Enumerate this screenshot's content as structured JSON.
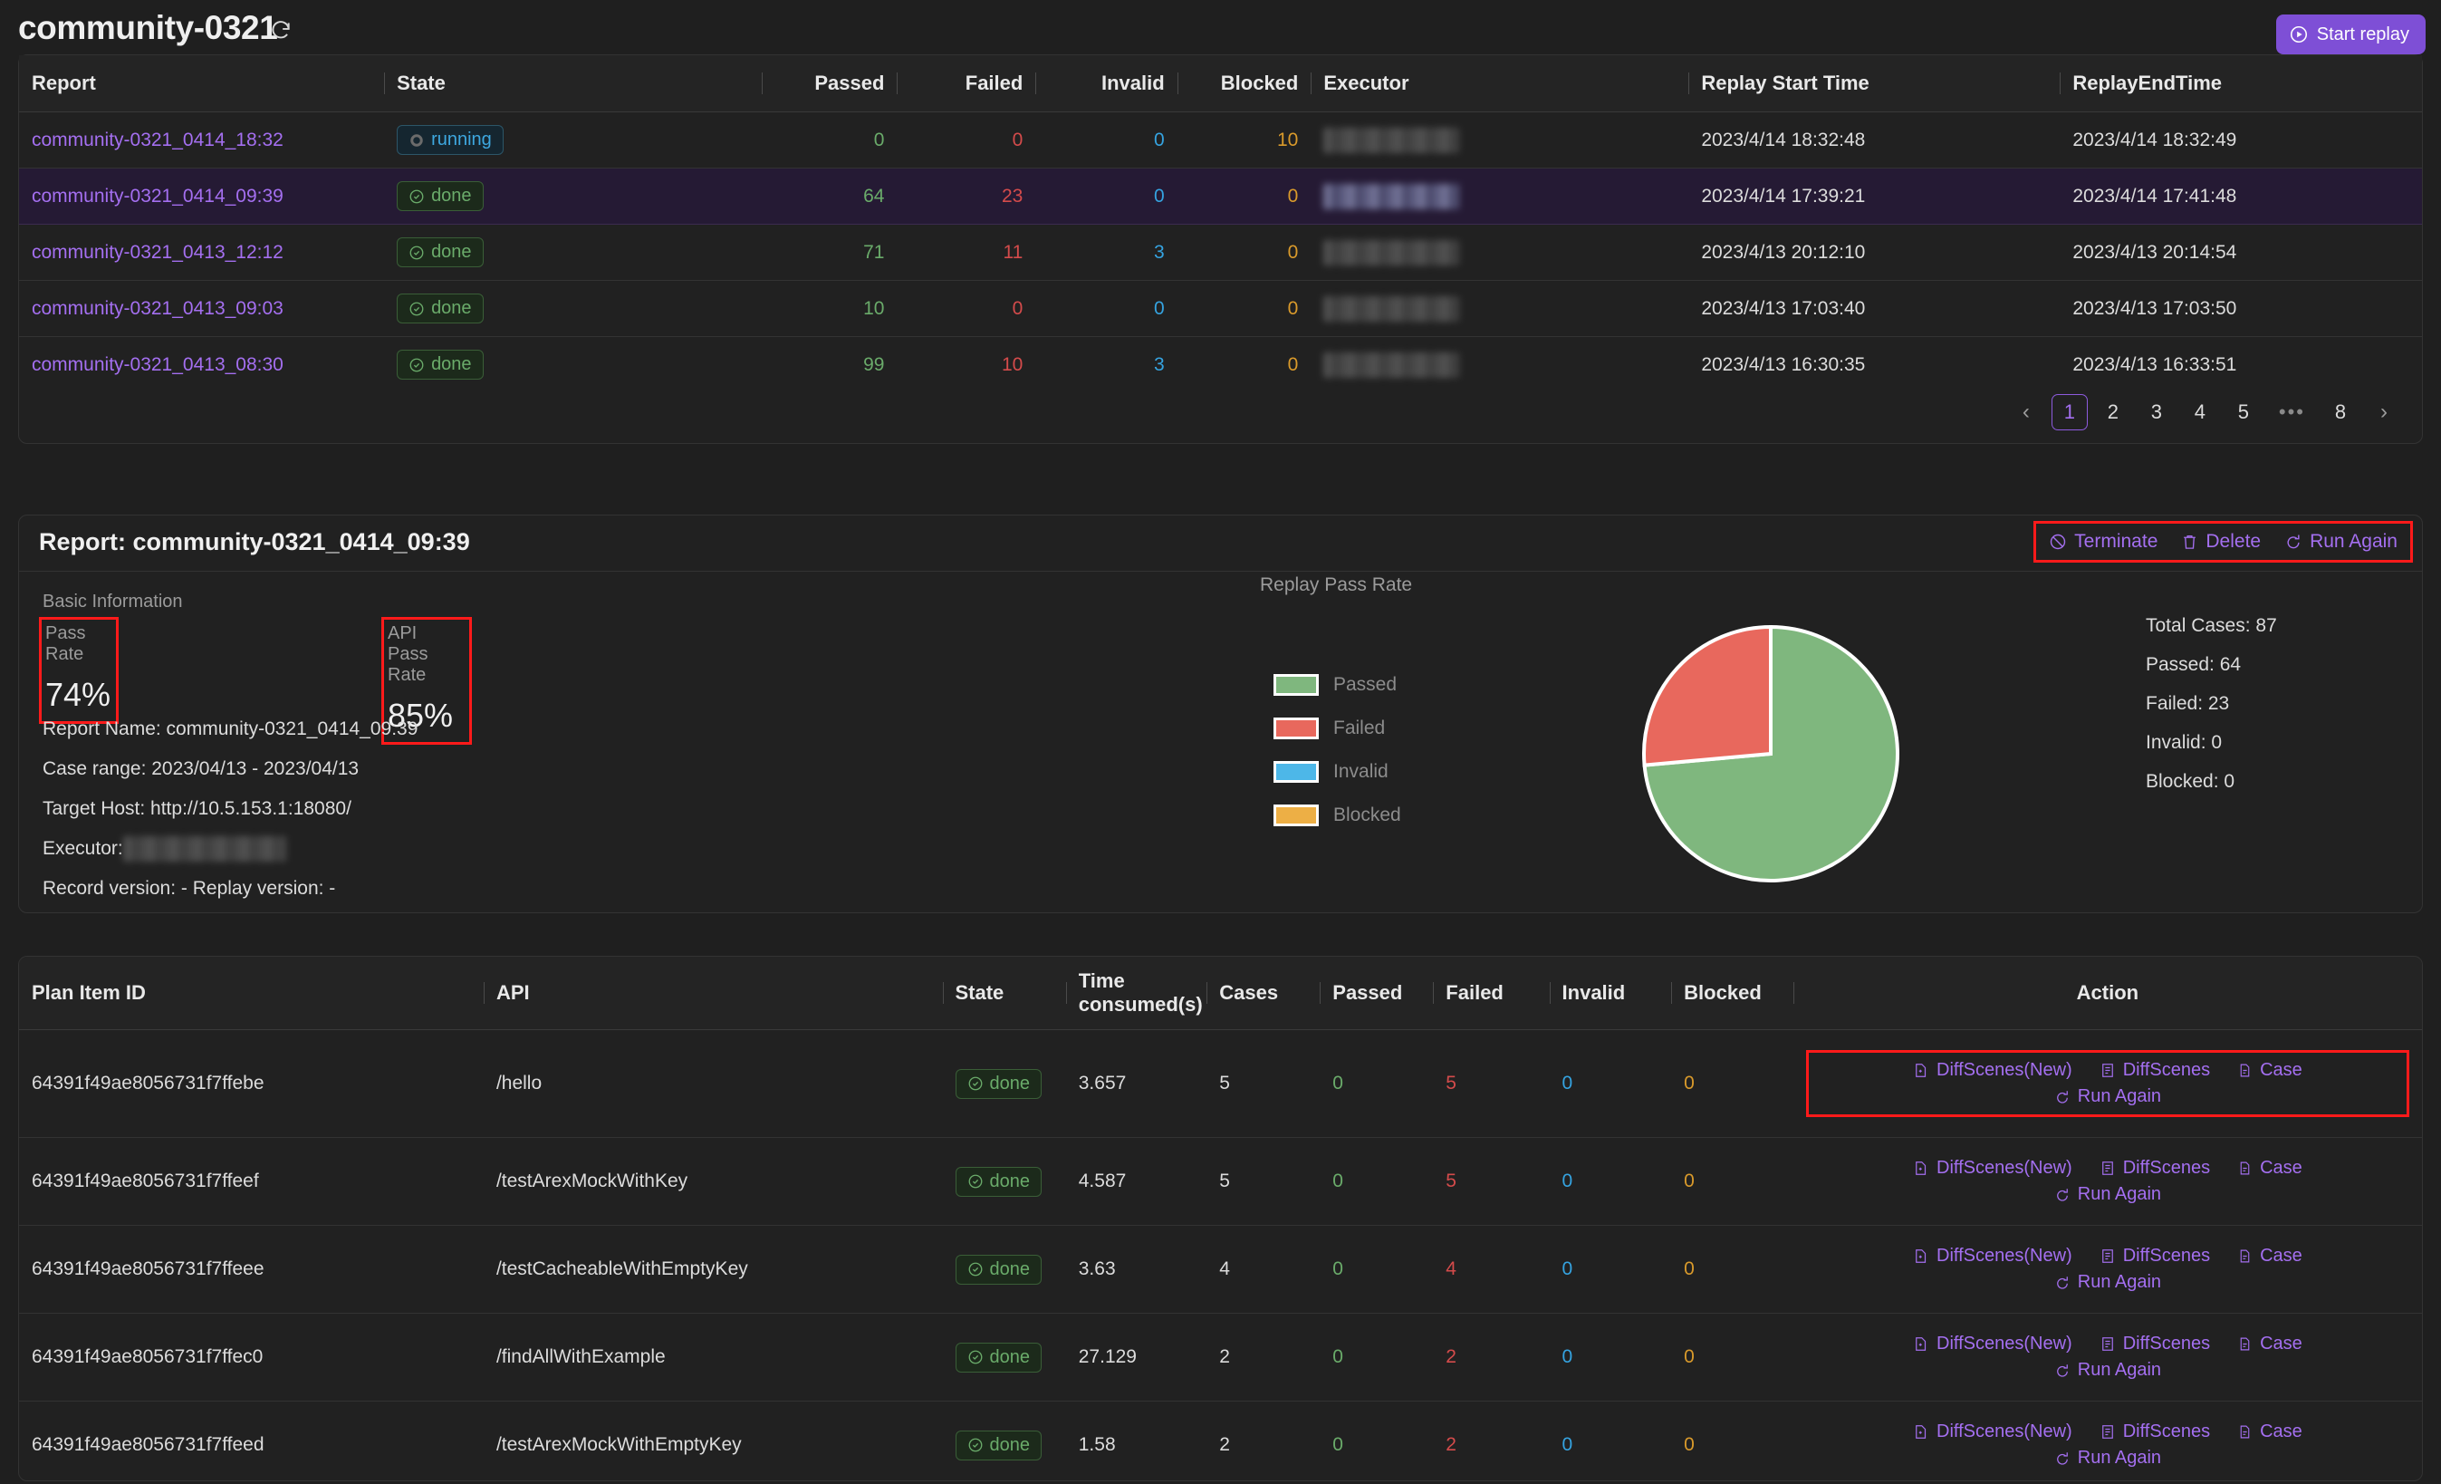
{
  "header": {
    "title": "community-0321",
    "refresh_icon": "refresh-icon",
    "start_replay_label": "Start replay"
  },
  "reports_table": {
    "columns": [
      "Report",
      "State",
      "Passed",
      "Failed",
      "Invalid",
      "Blocked",
      "Executor",
      "Replay Start Time",
      "ReplayEndTime"
    ],
    "rows": [
      {
        "report": "community-0321_0414_18:32",
        "state": "running",
        "passed": "0",
        "failed": "0",
        "invalid": "0",
        "blocked": "10",
        "executor": "",
        "start": "2023/4/14 18:32:48",
        "end": "2023/4/14 18:32:49",
        "selected": false
      },
      {
        "report": "community-0321_0414_09:39",
        "state": "done",
        "passed": "64",
        "failed": "23",
        "invalid": "0",
        "blocked": "0",
        "executor": "",
        "start": "2023/4/14 17:39:21",
        "end": "2023/4/14 17:41:48",
        "selected": true
      },
      {
        "report": "community-0321_0413_12:12",
        "state": "done",
        "passed": "71",
        "failed": "11",
        "invalid": "3",
        "blocked": "0",
        "executor": "",
        "start": "2023/4/13 20:12:10",
        "end": "2023/4/13 20:14:54",
        "selected": false
      },
      {
        "report": "community-0321_0413_09:03",
        "state": "done",
        "passed": "10",
        "failed": "0",
        "invalid": "0",
        "blocked": "0",
        "executor": "",
        "start": "2023/4/13 17:03:40",
        "end": "2023/4/13 17:03:50",
        "selected": false
      },
      {
        "report": "community-0321_0413_08:30",
        "state": "done",
        "passed": "99",
        "failed": "10",
        "invalid": "3",
        "blocked": "0",
        "executor": "",
        "start": "2023/4/13 16:30:35",
        "end": "2023/4/13 16:33:51",
        "selected": false
      }
    ]
  },
  "pagination": {
    "prev": "‹",
    "pages": [
      "1",
      "2",
      "3",
      "4",
      "5"
    ],
    "dots": "•••",
    "last": "8",
    "next": "›",
    "current": "1"
  },
  "report_detail": {
    "title": "Report: community-0321_0414_09:39",
    "actions": [
      {
        "label": "Terminate",
        "icon": "ban-icon"
      },
      {
        "label": "Delete",
        "icon": "trash-icon"
      },
      {
        "label": "Run Again",
        "icon": "rerun-icon"
      }
    ],
    "basic_information_label": "Basic Information",
    "pass_rate": {
      "label": "Pass Rate",
      "value": "74%"
    },
    "api_pass_rate": {
      "label": "API Pass Rate",
      "value": "85%"
    },
    "info_lines": [
      "Report Name: community-0321_0414_09:39",
      "Case range: 2023/04/13 - 2023/04/13",
      "Target Host: http://10.5.153.1:18080/",
      "Record version: - Replay version: -"
    ],
    "executor_line_label": "Executor:",
    "replay_pass_rate_label": "Replay Pass Rate",
    "stats": [
      "Total Cases: 87",
      "Passed: 64",
      "Failed: 23",
      "Invalid: 0",
      "Blocked: 0"
    ]
  },
  "chart_data": {
    "type": "pie",
    "title": "Replay Pass Rate",
    "categories": [
      "Passed",
      "Failed",
      "Invalid",
      "Blocked"
    ],
    "values": [
      64,
      23,
      0,
      0
    ],
    "colors": [
      "#7fb77e",
      "#e8685d",
      "#4db7e8",
      "#edaf45"
    ],
    "total": 87,
    "legend_position": "left",
    "slice_border": "#ffffff"
  },
  "plan_items_table": {
    "columns": [
      "Plan Item ID",
      "API",
      "State",
      "Time consumed(s)",
      "Cases",
      "Passed",
      "Failed",
      "Invalid",
      "Blocked",
      "Action"
    ],
    "action_labels": {
      "diff_scenes_new": "DiffScenes(New)",
      "diff_scenes": "DiffScenes",
      "case": "Case",
      "run_again": "Run Again"
    },
    "rows": [
      {
        "id": "64391f49ae8056731f7ffebe",
        "api": "/hello",
        "state": "done",
        "time": "3.657",
        "cases": "5",
        "passed": "0",
        "failed": "5",
        "invalid": "0",
        "blocked": "0",
        "highlight": true
      },
      {
        "id": "64391f49ae8056731f7ffeef",
        "api": "/testArexMockWithKey",
        "state": "done",
        "time": "4.587",
        "cases": "5",
        "passed": "0",
        "failed": "5",
        "invalid": "0",
        "blocked": "0",
        "highlight": false
      },
      {
        "id": "64391f49ae8056731f7ffeee",
        "api": "/testCacheableWithEmptyKey",
        "state": "done",
        "time": "3.63",
        "cases": "4",
        "passed": "0",
        "failed": "4",
        "invalid": "0",
        "blocked": "0",
        "highlight": false
      },
      {
        "id": "64391f49ae8056731f7ffec0",
        "api": "/findAllWithExample",
        "state": "done",
        "time": "27.129",
        "cases": "2",
        "passed": "0",
        "failed": "2",
        "invalid": "0",
        "blocked": "0",
        "highlight": false
      },
      {
        "id": "64391f49ae8056731f7ffeed",
        "api": "/testArexMockWithEmptyKey",
        "state": "done",
        "time": "1.58",
        "cases": "2",
        "passed": "0",
        "failed": "2",
        "invalid": "0",
        "blocked": "0",
        "highlight": false
      }
    ]
  },
  "theme": {
    "accent": "#7e4fd6",
    "link": "#a46ff0",
    "pass": "#6aab6a",
    "fail": "#d44b4b",
    "invalid": "#35a3e0",
    "blocked": "#d99a2b",
    "highlight_border": "#ff1a1a",
    "bg": "#1f1f1f",
    "panel_bg": "#212121"
  }
}
